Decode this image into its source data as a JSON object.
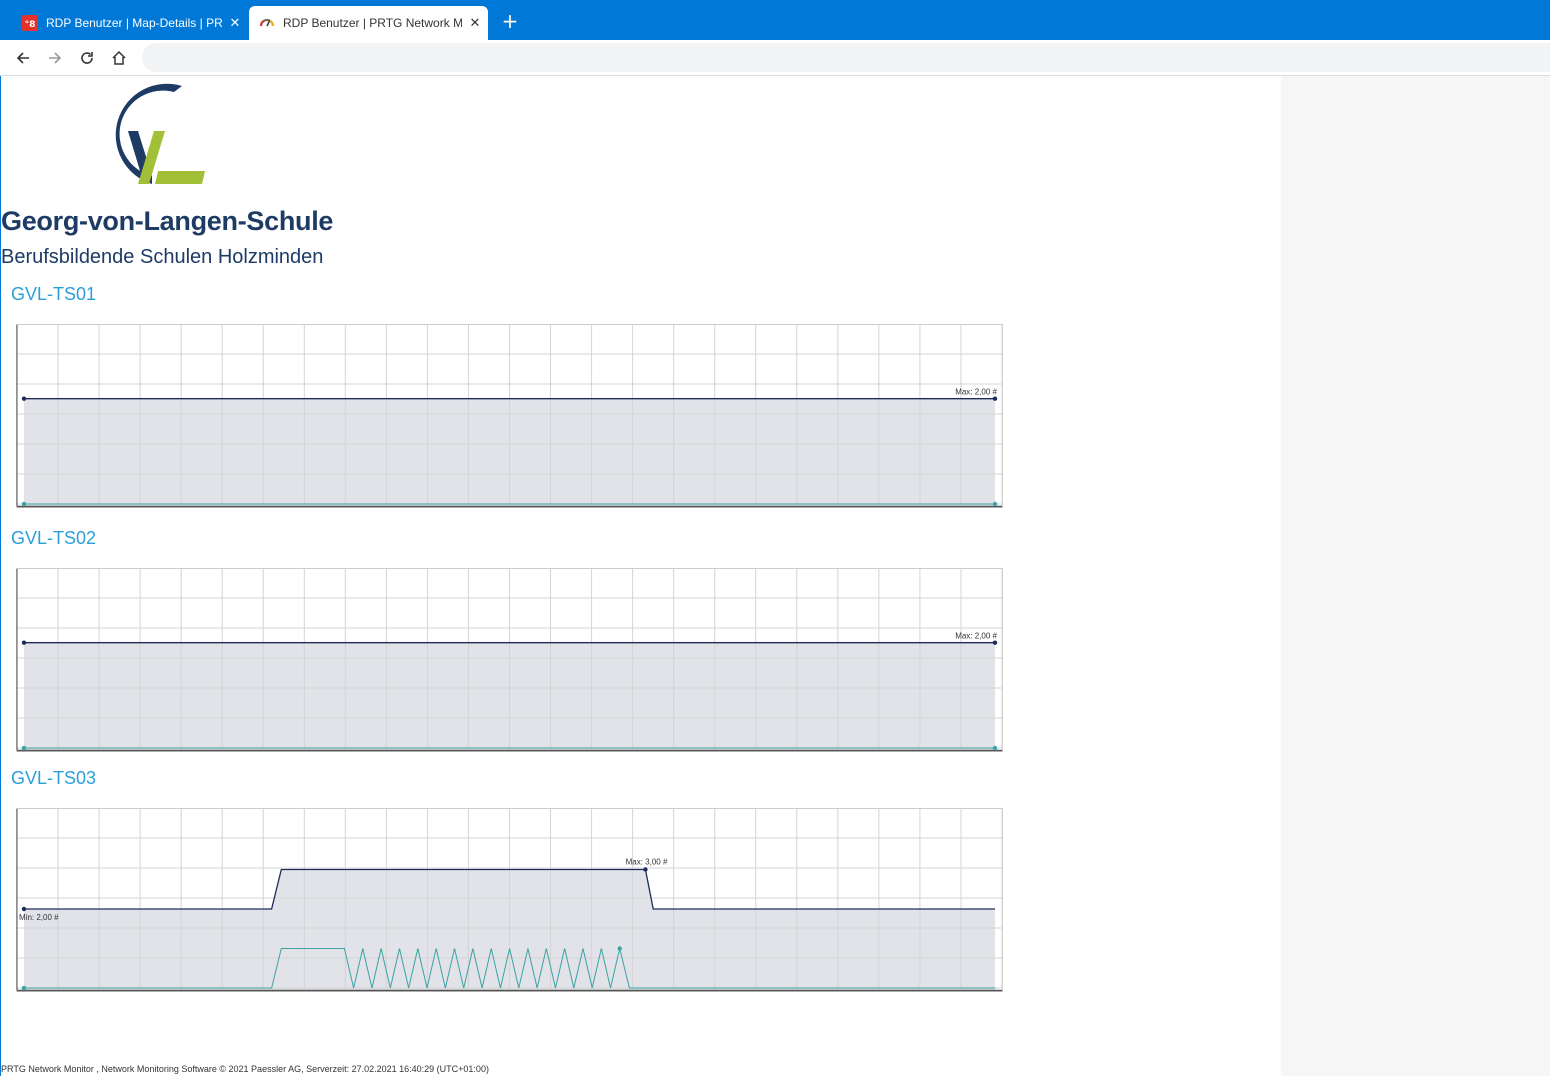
{
  "browser": {
    "tabs": [
      {
        "title": "RDP Benutzer | Map-Details | PRT",
        "close": "✕",
        "active": false
      },
      {
        "title": "RDP Benutzer | PRTG Network Mo",
        "close": "✕",
        "active": true
      }
    ],
    "new_tab": "+",
    "address": ""
  },
  "header": {
    "logo_text": "GVL",
    "school_name": "Georg-von-Langen-Schule",
    "school_subtitle": "Berufsbildende Schulen Holzminden"
  },
  "colors": {
    "tab_bar": "#0078d7",
    "school_text": "#1d3b64",
    "section_title": "#2b9fd8",
    "logo_blue": "#1d3b64",
    "logo_green": "#a2c037",
    "series_dark": "#1d2b5b",
    "series_teal": "#3aa3a3",
    "chart_fill": "#e1e3e9"
  },
  "sections": [
    {
      "title": "GVL-TS01"
    },
    {
      "title": "GVL-TS02"
    },
    {
      "title": "GVL-TS03"
    }
  ],
  "chart_data": [
    {
      "type": "area",
      "title": "GVL-TS01",
      "ylim": [
        0,
        3
      ],
      "grid": true,
      "x": [
        0,
        1
      ],
      "series": [
        {
          "values": [
            2,
            2
          ]
        },
        {
          "values": [
            0,
            0
          ]
        }
      ],
      "annotations": [
        {
          "text": "Max: 2,00 #"
        }
      ]
    },
    {
      "type": "area",
      "title": "GVL-TS02",
      "ylim": [
        0,
        3
      ],
      "grid": true,
      "x": [
        0,
        1
      ],
      "series": [
        {
          "values": [
            2,
            2
          ]
        },
        {
          "values": [
            0,
            0
          ]
        }
      ],
      "annotations": [
        {
          "text": "Max: 2,00 #"
        }
      ]
    },
    {
      "type": "area",
      "title": "GVL-TS03",
      "ylim": [
        0,
        4
      ],
      "grid": true,
      "x": [
        0,
        0.255,
        0.265,
        0.64,
        0.648,
        1
      ],
      "series": [
        {
          "values": [
            2,
            2,
            3,
            3,
            2,
            2
          ]
        },
        {
          "x": [
            0,
            0.255,
            0.265,
            0.32,
            0.33,
            0.6135,
            0.6235,
            1
          ],
          "values": [
            0,
            0,
            1,
            1,
            "zigzag",
            1,
            0,
            0
          ]
        }
      ],
      "zigzag": {
        "x_start": 0.33,
        "x_end": 0.6135,
        "peaks": 15,
        "high": 1,
        "low": 0
      },
      "annotations": [
        {
          "text": "Max: 3,00 #"
        },
        {
          "text": "Min: 2,00 #"
        }
      ]
    }
  ],
  "footer": {
    "text": "PRTG Network Monitor , Network Monitoring Software © 2021 Paessler AG, Serverzeit: 27.02.2021 16:40:29 (UTC+01:00)"
  }
}
